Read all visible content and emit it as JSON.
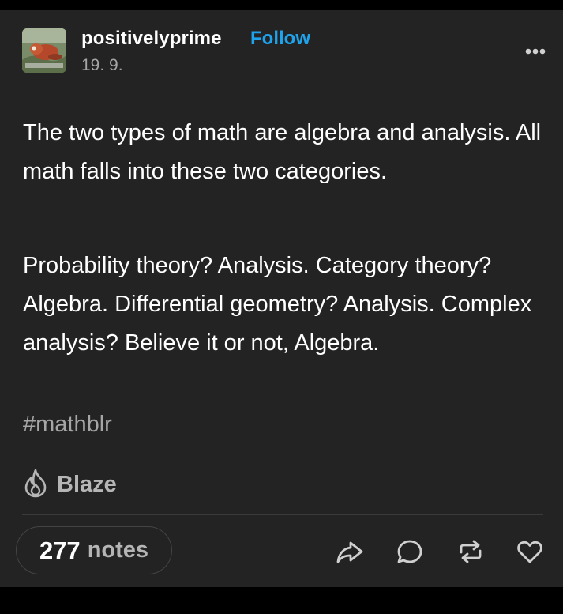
{
  "post": {
    "blog_name": "positivelyprime",
    "follow_label": "Follow",
    "date": "19. 9.",
    "paragraphs": [
      "The two types of math are algebra and analysis. All math falls into these two categories.",
      "Probability theory? Analysis. Category theory? Algebra. Differential geometry? Analysis. Complex analysis? Believe it or not, Algebra."
    ],
    "tags": [
      "#mathblr"
    ],
    "blaze_label": "Blaze"
  },
  "footer": {
    "notes_count": "277",
    "notes_label": "notes",
    "actions": [
      "share-icon",
      "reply-icon",
      "reblog-icon",
      "like-icon"
    ]
  },
  "colors": {
    "background": "#000000",
    "card": "#232323",
    "accent": "#1fa3ed",
    "muted_text": "#a6a6a6"
  }
}
